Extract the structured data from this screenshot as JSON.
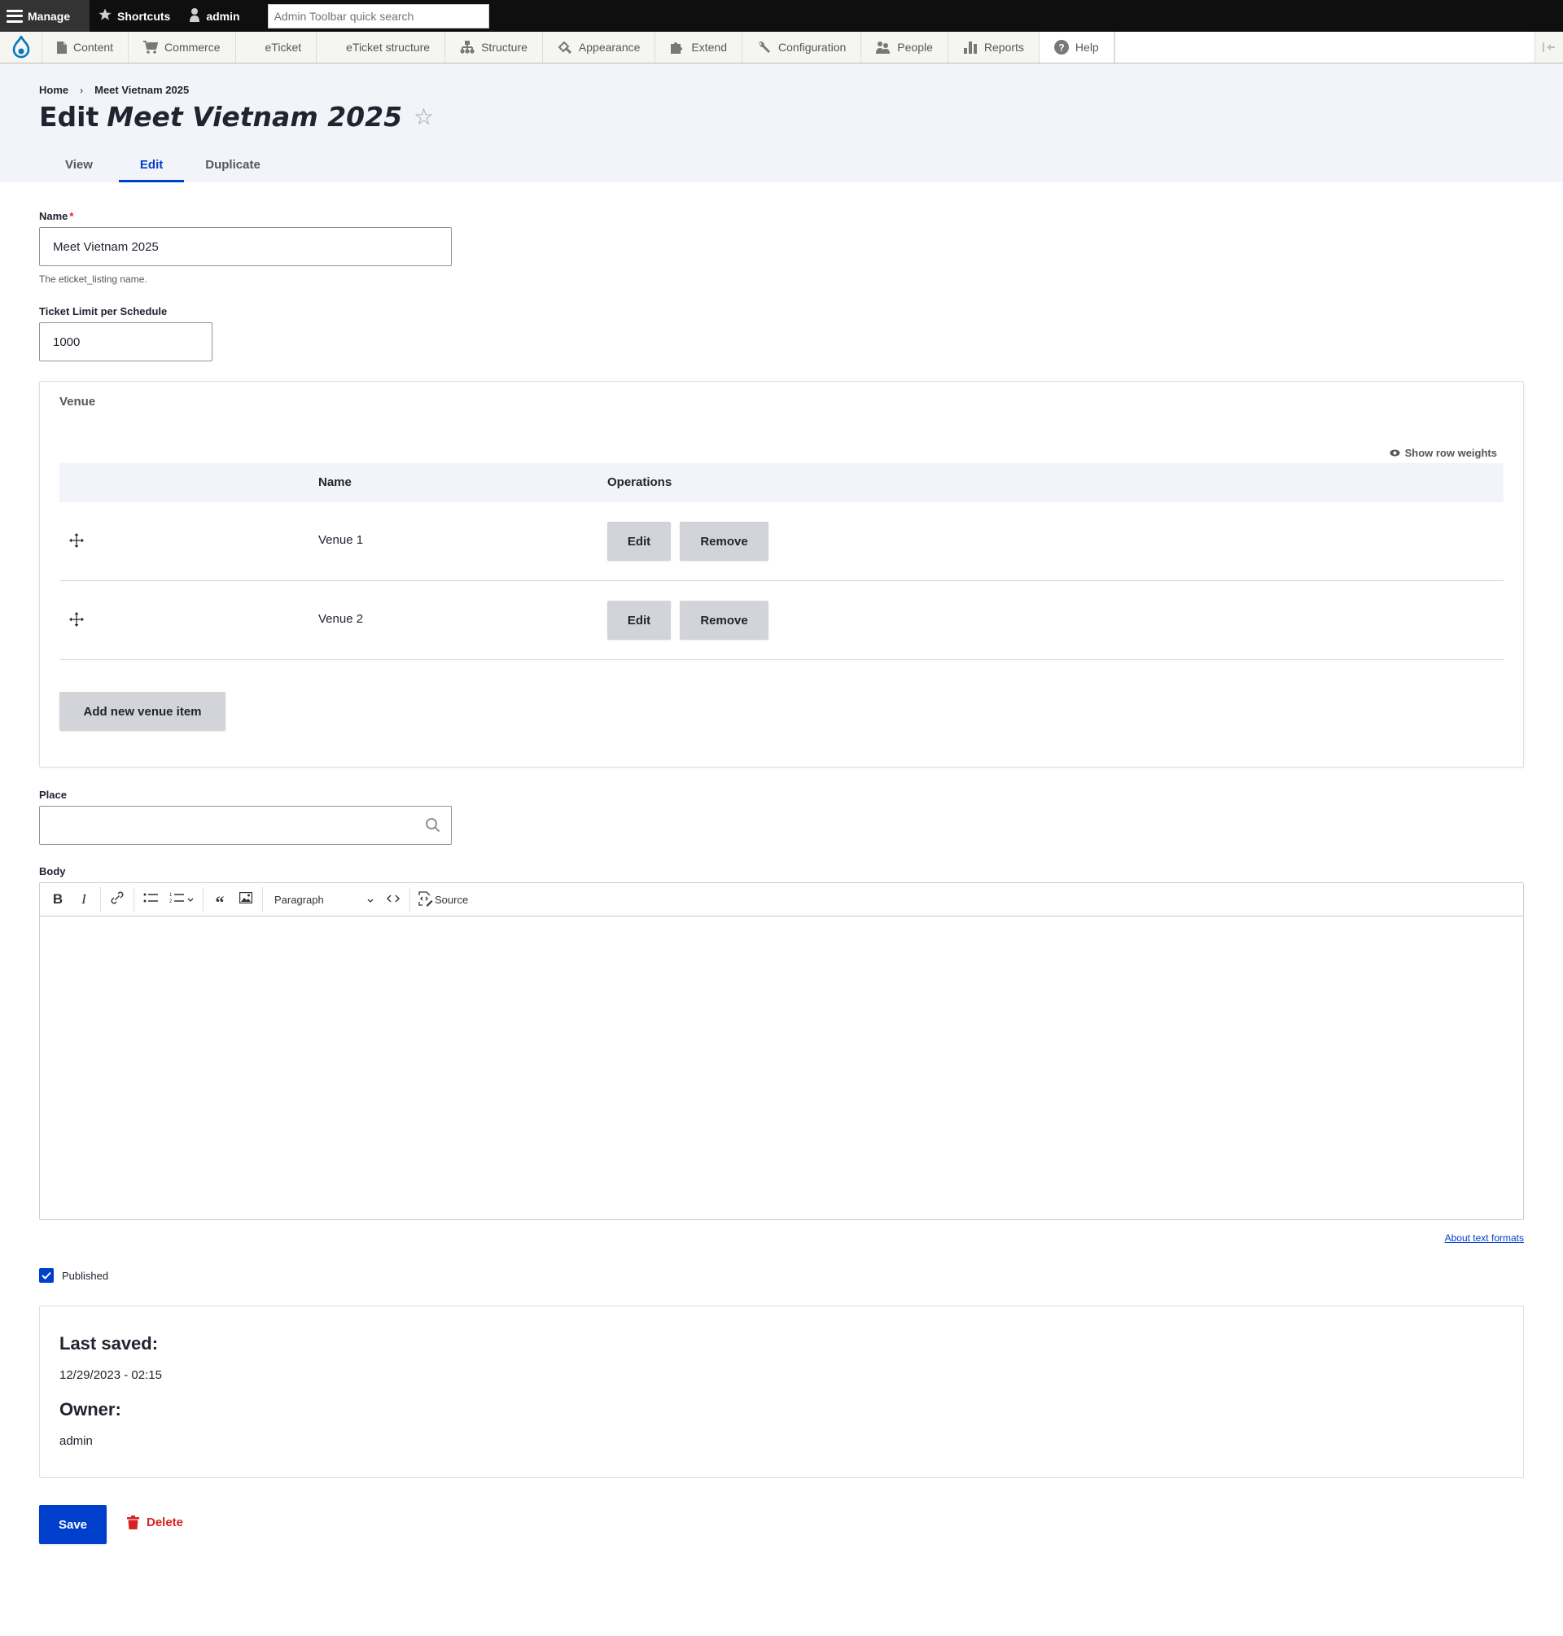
{
  "toolbar": {
    "manage_label": "Manage",
    "shortcuts_label": "Shortcuts",
    "user_label": "admin",
    "search_placeholder": "Admin Toolbar quick search"
  },
  "tray": {
    "items": [
      {
        "label": "Content",
        "icon": "file-icon"
      },
      {
        "label": "Commerce",
        "icon": "cart-icon"
      },
      {
        "label": "eTicket",
        "icon": ""
      },
      {
        "label": "eTicket structure",
        "icon": ""
      },
      {
        "label": "Structure",
        "icon": "sitemap-icon"
      },
      {
        "label": "Appearance",
        "icon": "paintbrush-icon"
      },
      {
        "label": "Extend",
        "icon": "puzzle-icon"
      },
      {
        "label": "Configuration",
        "icon": "wrench-icon"
      },
      {
        "label": "People",
        "icon": "people-icon"
      },
      {
        "label": "Reports",
        "icon": "bar-chart-icon"
      },
      {
        "label": "Help",
        "icon": "help-icon"
      }
    ]
  },
  "breadcrumb": {
    "items": [
      "Home",
      "Meet Vietnam 2025"
    ],
    "separator": "›"
  },
  "page": {
    "title_prefix": "Edit",
    "title_entity": "Meet Vietnam 2025",
    "star": "☆"
  },
  "tabs": [
    {
      "label": "View",
      "active": false
    },
    {
      "label": "Edit",
      "active": true
    },
    {
      "label": "Duplicate",
      "active": false
    }
  ],
  "form": {
    "name": {
      "label": "Name",
      "required_marker": "*",
      "value": "Meet Vietnam 2025",
      "description": "The eticket_listing name."
    },
    "ticket_limit": {
      "label": "Ticket Limit per Schedule",
      "value": "1000"
    },
    "venue": {
      "legend": "Venue",
      "show_row_weights": "Show row weights",
      "columns": [
        "",
        "Name",
        "Operations"
      ],
      "rows": [
        {
          "name": "Venue 1",
          "edit_label": "Edit",
          "remove_label": "Remove"
        },
        {
          "name": "Venue 2",
          "edit_label": "Edit",
          "remove_label": "Remove"
        }
      ],
      "add_label": "Add new venue item"
    },
    "place": {
      "label": "Place",
      "value": ""
    },
    "body": {
      "label": "Body",
      "paragraph_format": "Paragraph",
      "source_label": "Source",
      "content": "",
      "about_formats": "About text formats"
    },
    "published": {
      "label": "Published",
      "checked": true
    },
    "meta": {
      "last_saved_label": "Last saved:",
      "last_saved_value": "12/29/2023 - 02:15",
      "owner_label": "Owner:",
      "owner_value": "admin"
    },
    "actions": {
      "save_label": "Save",
      "delete_label": "Delete"
    }
  },
  "colors": {
    "primary": "#003ecc",
    "danger": "#d72222",
    "header_bg": "#f3f4f9",
    "toolbar_bg": "#0f0f0f"
  }
}
